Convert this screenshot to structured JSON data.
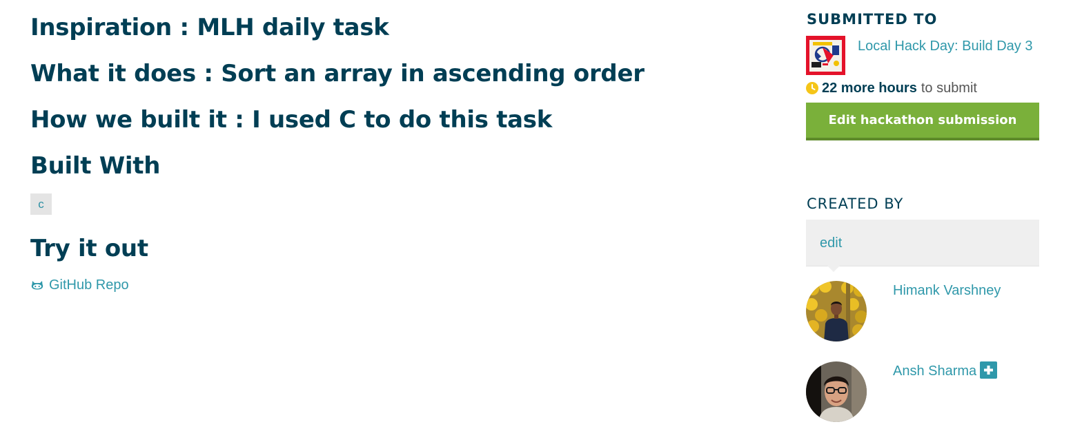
{
  "main": {
    "inspiration": "Inspiration : MLH daily task",
    "what_it_does": "What it does : Sort an array in ascending order",
    "how_built": "How we built it : I used C to do this task",
    "built_with_heading": "Built With",
    "built_with_tags": [
      "c"
    ],
    "try_it_out_heading": "Try it out",
    "repo_link_label": "GitHub Repo",
    "repo_icon": "github-icon"
  },
  "sidebar": {
    "submitted_to_heading": "SUBMITTED TO",
    "hackathon_name": "Local Hack Day: Build Day 3",
    "time_remaining_strong": "22 more hours",
    "time_remaining_suffix": "to submit",
    "clock_icon": "clock-icon",
    "edit_submission_label": "Edit hackathon submission",
    "created_by_heading": "CREATED BY",
    "edit_link_label": "edit",
    "members": [
      {
        "name": "Himank Varshney"
      },
      {
        "name": "Ansh Sharma"
      }
    ]
  },
  "colors": {
    "heading": "#003e54",
    "link": "#2f98aa",
    "button_green": "#7ab03a",
    "tag_bg": "#e4e4e4",
    "clock_yellow": "#f5c518"
  }
}
